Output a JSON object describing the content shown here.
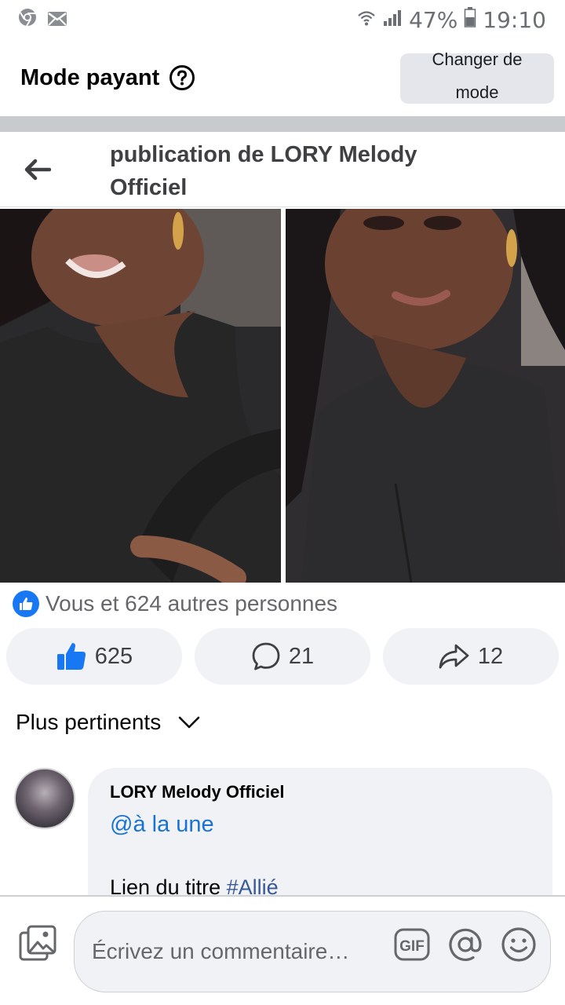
{
  "status_bar": {
    "battery": "47%",
    "time": "19:10",
    "icons": [
      "chrome-icon",
      "mail-icon",
      "wifi-icon",
      "signal-icon",
      "battery-icon"
    ]
  },
  "mode": {
    "title": "Mode payant",
    "switch_label": "Changer de mode"
  },
  "post": {
    "title": "publication de LORY Melody Officiel"
  },
  "reactions": {
    "summary": "Vous et 624 autres personnes",
    "likes": "625",
    "comments": "21",
    "shares": "12"
  },
  "sort": {
    "label": "Plus pertinents"
  },
  "comment": {
    "author": "LORY Melody Officiel",
    "mention": "@à la une",
    "text": "Lien du titre ",
    "hashtag": "#Allié"
  },
  "composer": {
    "placeholder": "Écrivez un commentaire…"
  },
  "colors": {
    "accent": "#1877f2",
    "mention": "#1a73d1",
    "hashtag": "#385898",
    "button_bg": "#f0f2f5"
  }
}
